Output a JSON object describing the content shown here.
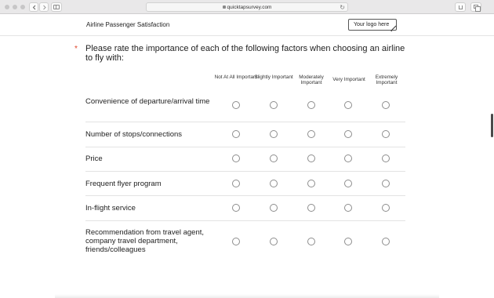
{
  "browser": {
    "url": "quicktapsurvey.com",
    "reload_icon": "reload-icon"
  },
  "survey": {
    "title": "Airline Passenger Satisfaction",
    "logo_placeholder": "Your logo here"
  },
  "question": {
    "required_mark": "*",
    "text": "Please rate the importance of each of the following factors when choosing an airline to fly with:",
    "columns": [
      "Not At All Important",
      "Slightly Important",
      "Moderately Important",
      "Very Important",
      "Extremely Important"
    ],
    "rows": [
      "Convenience of departure/arrival time",
      "Number of stops/connections",
      "Price",
      "Frequent flyer program",
      "In-flight service",
      "Recommendation from travel agent, company travel department, friends/colleagues"
    ]
  },
  "colors": {
    "required": "#e0442b",
    "radio_border": "#8d8d8d",
    "divider": "#e3e3e3"
  }
}
